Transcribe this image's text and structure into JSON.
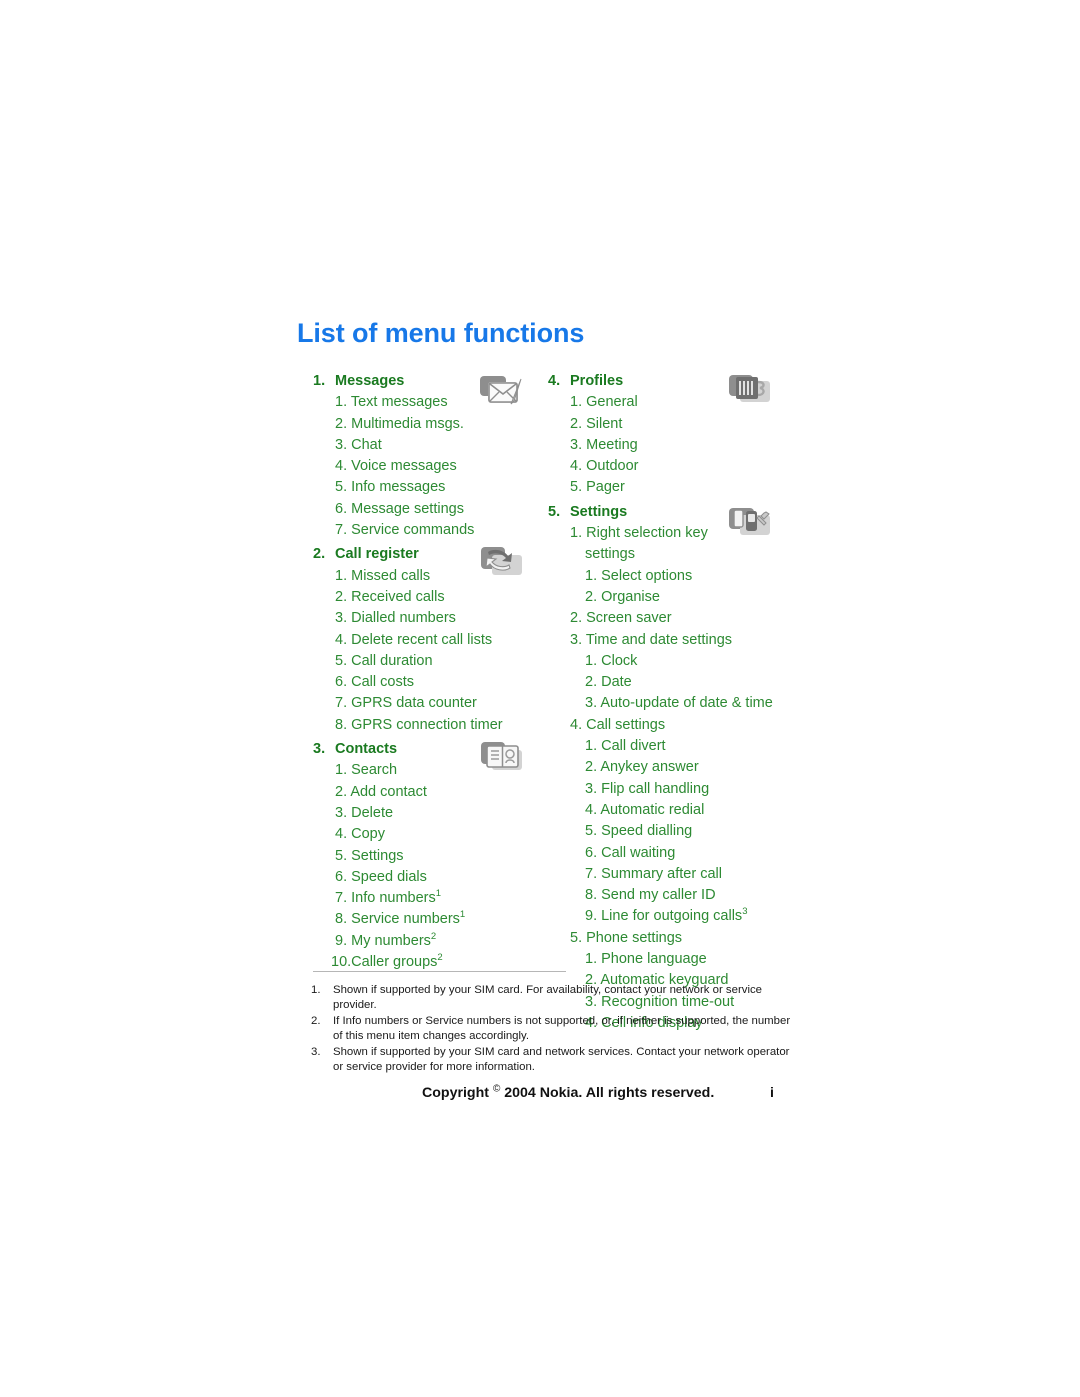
{
  "document": {
    "title": "List of menu functions",
    "title_color": "#1778e8",
    "menu_color": "#2d8a33",
    "heading_color": "#1a7a20"
  },
  "columns": {
    "left": [
      {
        "number": "1.",
        "label": "Messages",
        "icon": "envelope-pen-icon",
        "items": [
          {
            "text": "1. Text messages"
          },
          {
            "text": "2. Multimedia msgs."
          },
          {
            "text": "3. Chat"
          },
          {
            "text": "4. Voice messages"
          },
          {
            "text": "5. Info messages"
          },
          {
            "text": "6. Message settings"
          },
          {
            "text": "7. Service commands"
          }
        ]
      },
      {
        "number": "2.",
        "label": "Call register",
        "icon": "call-arrows-icon",
        "items": [
          {
            "text": "1. Missed calls"
          },
          {
            "text": "2. Received calls"
          },
          {
            "text": "3. Dialled numbers"
          },
          {
            "text": "4. Delete recent call lists"
          },
          {
            "text": "5. Call duration"
          },
          {
            "text": "6. Call costs"
          },
          {
            "text": "7. GPRS data counter"
          },
          {
            "text": "8. GPRS connection timer"
          }
        ]
      },
      {
        "number": "3.",
        "label": "Contacts",
        "icon": "address-book-icon",
        "items": [
          {
            "text": "1. Search"
          },
          {
            "text": "2. Add contact"
          },
          {
            "text": "3. Delete"
          },
          {
            "text": "4. Copy"
          },
          {
            "text": "5. Settings"
          },
          {
            "text": "6. Speed dials"
          },
          {
            "text": "7. Info numbers",
            "sup": "1"
          },
          {
            "text": "8. Service numbers",
            "sup": "1"
          },
          {
            "text": "9. My numbers",
            "sup": "2"
          },
          {
            "text": "10.Caller groups",
            "sup": "2",
            "tight": true
          }
        ]
      }
    ],
    "right": [
      {
        "number": "4.",
        "label": "Profiles",
        "icon": "profiles-icon",
        "items": [
          {
            "text": "1. General"
          },
          {
            "text": "2. Silent"
          },
          {
            "text": "3. Meeting"
          },
          {
            "text": "4. Outdoor"
          },
          {
            "text": "5. Pager"
          }
        ]
      },
      {
        "number": "5.",
        "label": "Settings",
        "icon": "settings-wrench-icon",
        "items": [
          {
            "text": "1. Right selection key",
            "cont": "settings"
          },
          {
            "text": "1. Select options",
            "level": 2
          },
          {
            "text": "2. Organise",
            "level": 2
          },
          {
            "text": "2. Screen saver"
          },
          {
            "text": "3. Time and date settings"
          },
          {
            "text": "1. Clock",
            "level": 2
          },
          {
            "text": "2. Date",
            "level": 2
          },
          {
            "text": "3. Auto-update of date & time",
            "level": 2
          },
          {
            "text": "4. Call settings"
          },
          {
            "text": "1. Call divert",
            "level": 2
          },
          {
            "text": "2. Anykey answer",
            "level": 2
          },
          {
            "text": "3. Flip call handling",
            "level": 2
          },
          {
            "text": "4. Automatic redial",
            "level": 2
          },
          {
            "text": "5. Speed dialling",
            "level": 2
          },
          {
            "text": "6. Call waiting",
            "level": 2
          },
          {
            "text": "7. Summary after call",
            "level": 2
          },
          {
            "text": "8. Send my caller ID",
            "level": 2
          },
          {
            "text": "9. Line for outgoing calls",
            "sup": "3",
            "level": 2
          },
          {
            "text": "5. Phone settings"
          },
          {
            "text": "1. Phone language",
            "level": 2
          },
          {
            "text": "2. Automatic keyguard",
            "level": 2
          },
          {
            "text": "3. Recognition time-out",
            "level": 2
          },
          {
            "text": "4. Cell info display",
            "level": 2
          }
        ]
      }
    ]
  },
  "footnotes": [
    {
      "number": "1.",
      "text": "Shown if supported by your SIM card. For availability, contact your network or service provider."
    },
    {
      "number": "2.",
      "text": "If Info numbers or Service numbers is not supported, or, if neither is supported, the number of this menu item changes accordingly."
    },
    {
      "number": "3.",
      "text": "Shown if supported by your SIM card and network services. Contact your network operator or service provider for more information."
    }
  ],
  "footer": {
    "copyright_pre": "Copyright ",
    "copyright_mark": "©",
    "copyright_post": " 2004 Nokia. All rights reserved.",
    "page_number": "i"
  }
}
